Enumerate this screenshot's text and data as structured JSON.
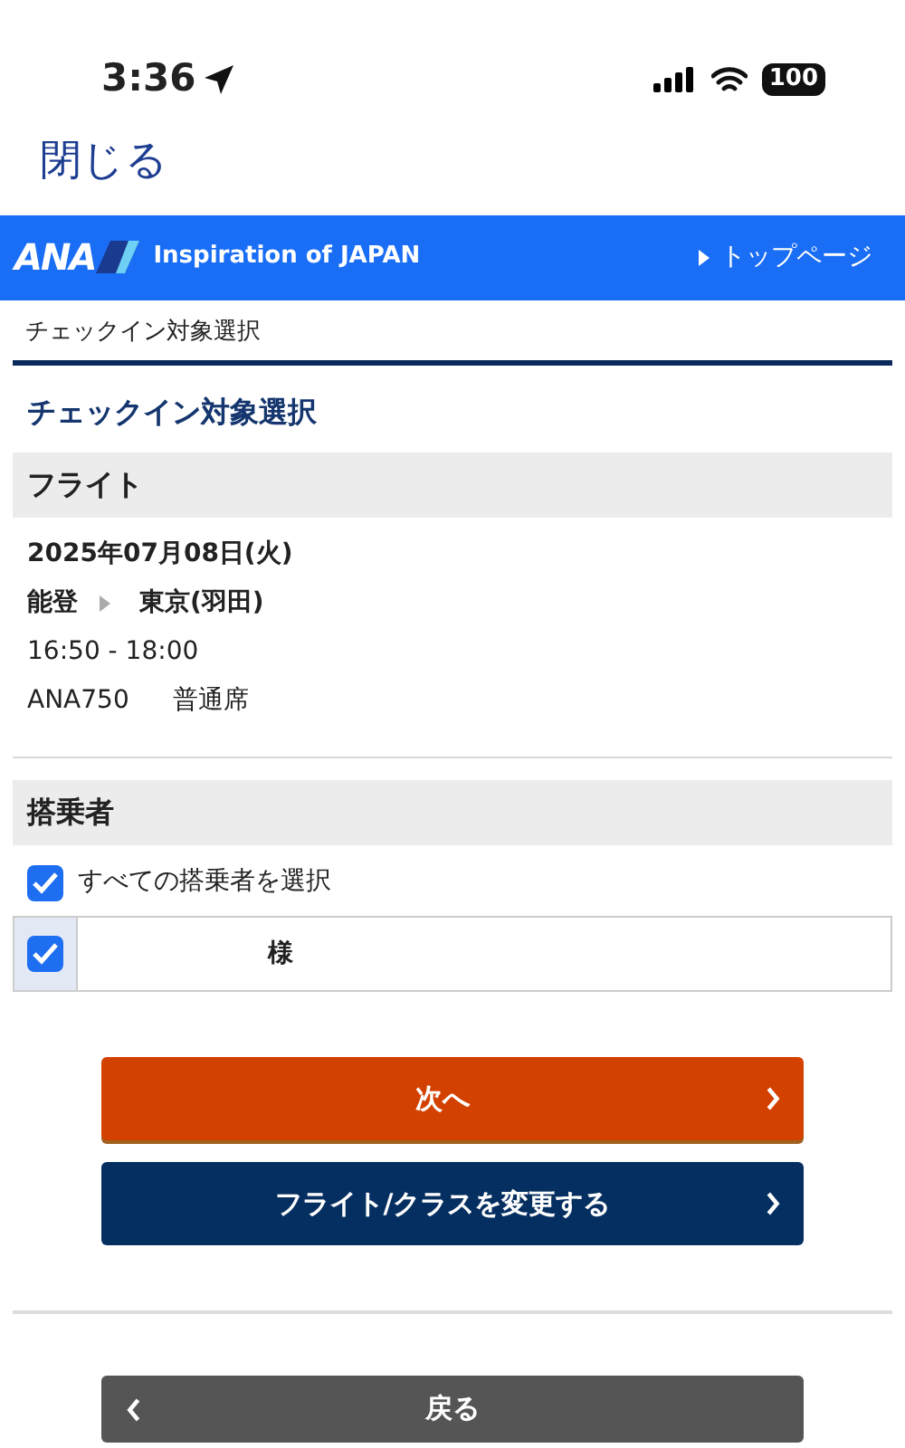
{
  "status_bar": {
    "time": "3:36",
    "battery": "100"
  },
  "close_link": "閉じる",
  "header": {
    "logo": "ANA",
    "tagline": "Inspiration of JAPAN",
    "top_link": "トップページ"
  },
  "breadcrumb": "チェックイン対象選択",
  "page_title": "チェックイン対象選択",
  "flight_section": {
    "heading": "フライト",
    "date": "2025年07月08日(火)",
    "origin": "能登",
    "destination": "東京(羽田)",
    "time": "16:50 - 18:00",
    "flight_number": "ANA750",
    "cabin": "普通席"
  },
  "passenger_section": {
    "heading": "搭乗者",
    "select_all": {
      "label": "すべての搭乗者を選択",
      "checked": true
    },
    "passengers": [
      {
        "name": "様",
        "checked": true
      }
    ]
  },
  "buttons": [
    {
      "label": "次へ",
      "kind": "next"
    },
    {
      "label": "フライト/クラスを変更する",
      "kind": "change"
    },
    {
      "label": "戻る",
      "kind": "back"
    }
  ]
}
